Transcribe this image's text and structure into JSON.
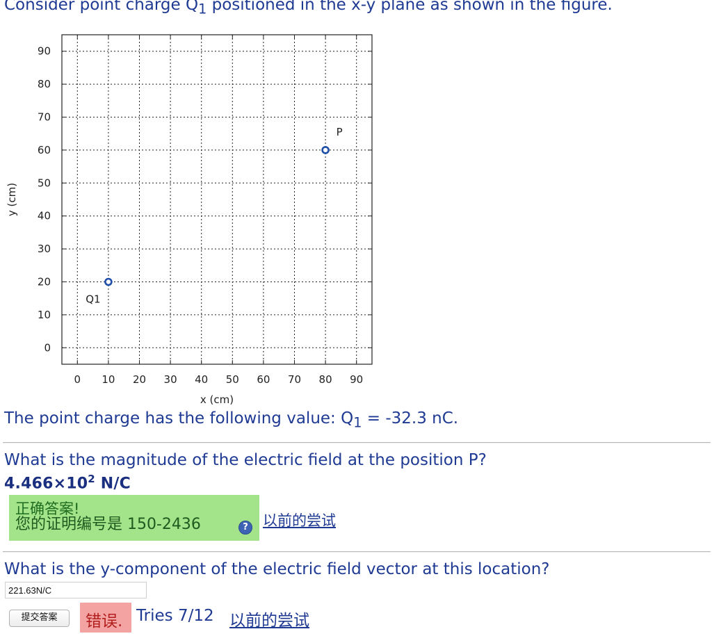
{
  "intro": {
    "before": "Consider point charge Q",
    "sub": "1",
    "after": " positioned in the x-y plane as shown in the figure."
  },
  "chart_data": {
    "type": "scatter",
    "xlabel": "x (cm)",
    "ylabel": "y (cm)",
    "xlim": [
      -5,
      95
    ],
    "ylim": [
      -5,
      95
    ],
    "xticks": [
      0,
      10,
      20,
      30,
      40,
      50,
      60,
      70,
      80,
      90
    ],
    "yticks": [
      0,
      10,
      20,
      30,
      40,
      50,
      60,
      70,
      80,
      90
    ],
    "grid": true,
    "points": [
      {
        "label": "Q1",
        "x": 10,
        "y": 20,
        "label_pos": "below-left"
      },
      {
        "label": "P",
        "x": 80,
        "y": 60,
        "label_pos": "above-right"
      }
    ],
    "colors": {
      "marker": "#1f4fa8",
      "grid": "#222222"
    }
  },
  "charge": {
    "before": "The point charge has the following value: Q",
    "sub": "1",
    "after": " = -32.3 nC."
  },
  "question1": {
    "text": "What is the magnitude of the electric field at the position P?",
    "answer_mantissa": "4.466×10",
    "answer_exp": "2",
    "answer_unit": " N/C",
    "correct_title": "正确答案!",
    "correct_text": "您的证明编号是 150-2436",
    "help_icon": "?",
    "previous_link": "以前的尝试"
  },
  "question2": {
    "text": "What is the y-component of the electric field vector at this location?",
    "input_value": "221.63N/C",
    "submit_label": "提交答案",
    "wrong_label": "错误.",
    "tries": "Tries 7/12",
    "previous_link": "以前的尝试"
  },
  "colors": {
    "correct_bg": "#a3e48a",
    "wrong_bg": "#f4a3a3",
    "text": "#1f3a93"
  }
}
